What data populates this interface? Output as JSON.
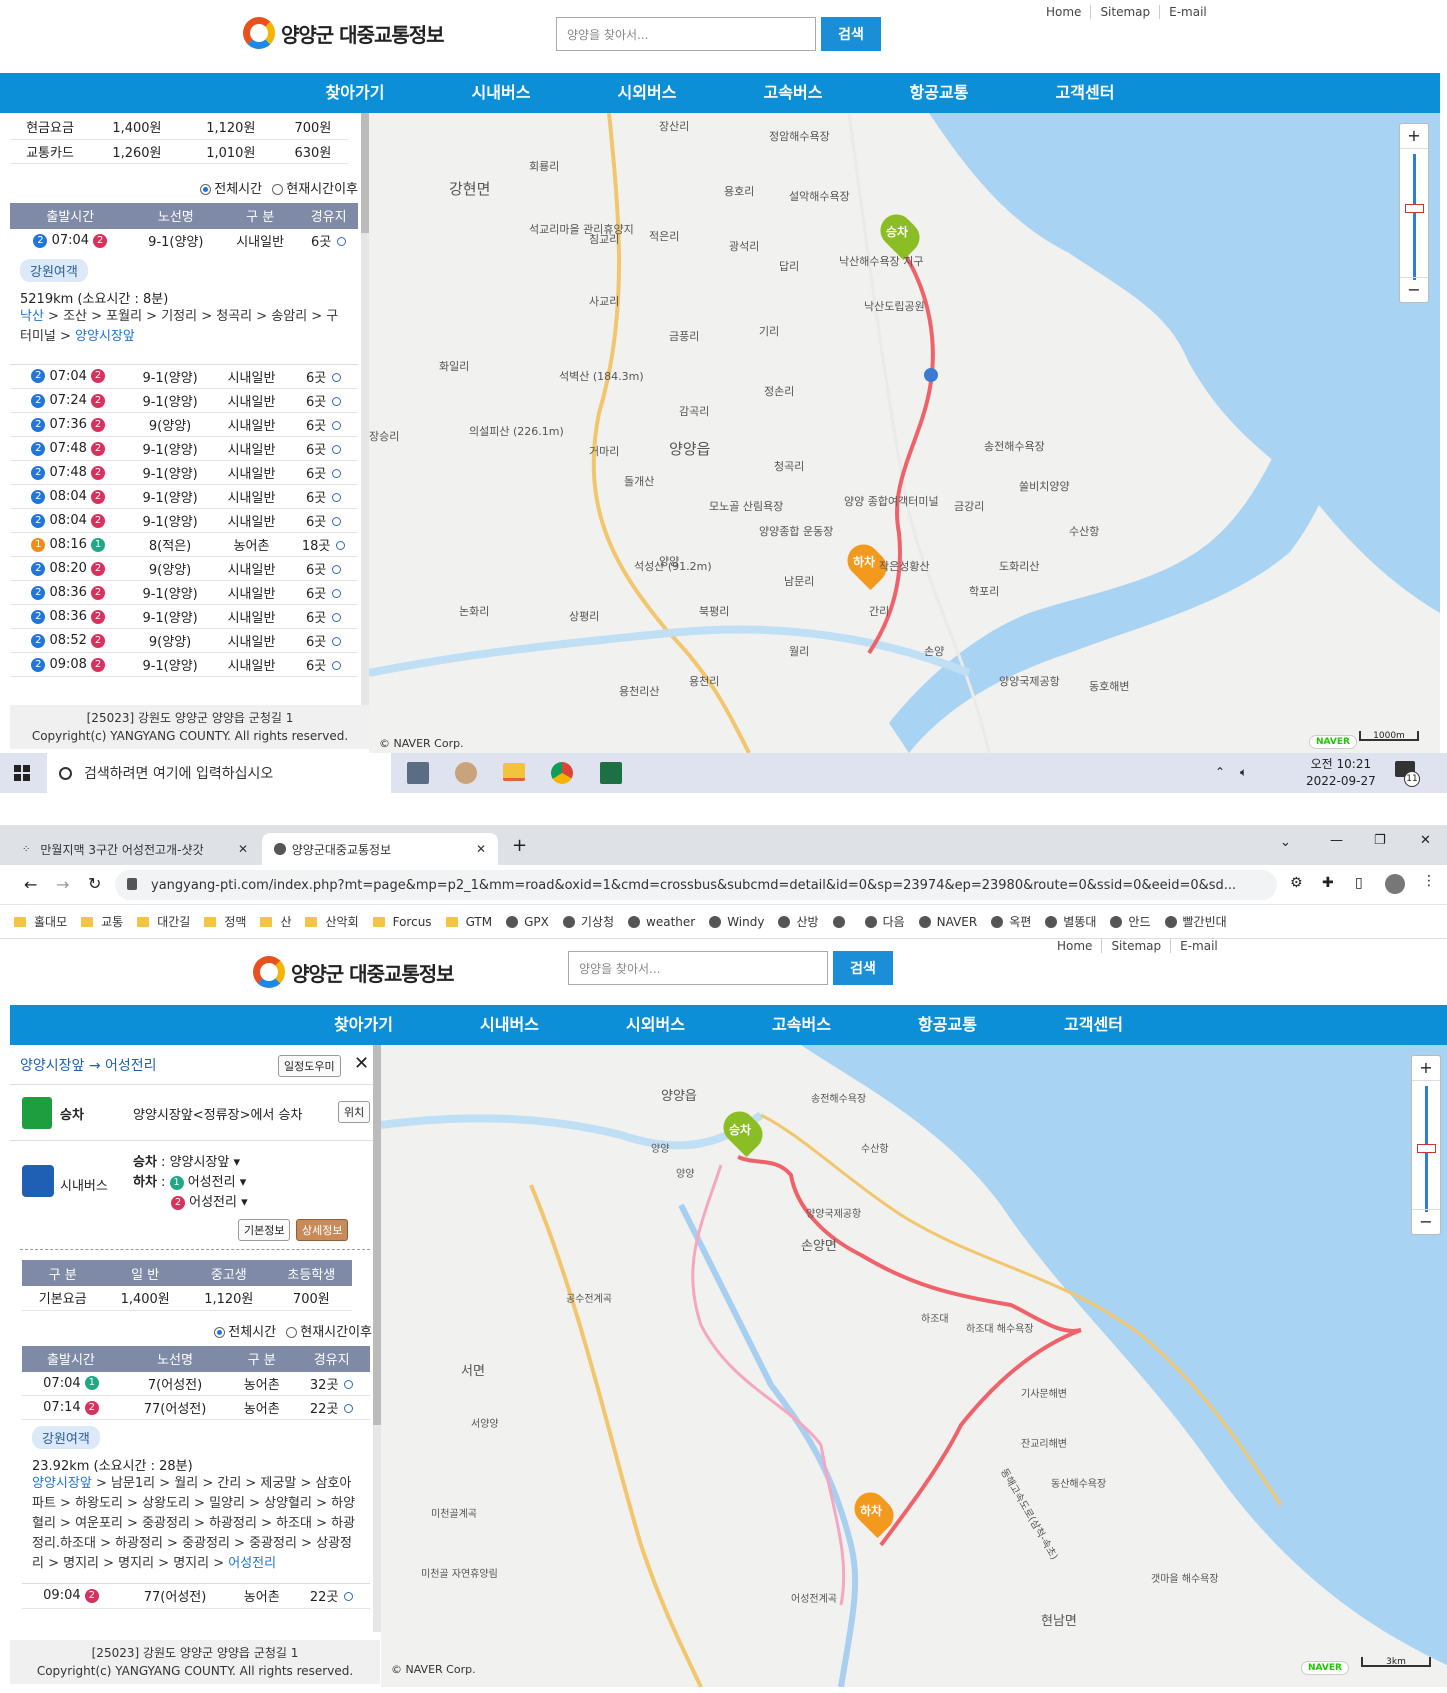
{
  "site": {
    "title": "양양군 대중교통정보",
    "search_placeholder": "양양을 찾아서...",
    "search_button": "검색",
    "top_links": [
      "Home",
      "Sitemap",
      "E-mail"
    ],
    "nav": [
      "찾아가기",
      "시내버스",
      "시외버스",
      "고속버스",
      "항공교통",
      "고객센터"
    ],
    "footer_address": "[25023] 강원도 양양군 양양읍 군청길 1",
    "footer_copyright": "Copyright(c) YANGYANG COUNTY. All rights reserved."
  },
  "top": {
    "fare_rows": [
      {
        "label": "현금요금",
        "general": "1,400원",
        "youth": "1,120원",
        "child": "700원"
      },
      {
        "label": "교통카드",
        "general": "1,260원",
        "youth": "1,010원",
        "child": "630원"
      }
    ],
    "radio_all": "전체시간",
    "radio_after": "현재시간이후",
    "headers": [
      "출발시간",
      "노선명",
      "구 분",
      "경유지"
    ],
    "first_row": {
      "num": "2",
      "time": "07:04",
      "rn": "2",
      "route": "9-1(양양)",
      "type": "시내일반",
      "stops": "6곳"
    },
    "detail": {
      "tag": "강원여객",
      "summary": "5219km (소요시간 : 8분)",
      "stops_start": "낙산",
      "stops_middle": " > 조산 > 포월리 > 기정리 > 청곡리 > 송암리 > 구터미널 > ",
      "stops_end": "양양시장앞"
    },
    "rows": [
      {
        "num": "2",
        "time": "07:04",
        "rn": "2",
        "route": "9-1(양양)",
        "type": "시내일반",
        "stops": "6곳",
        "color": "blue",
        "rcolor": "red"
      },
      {
        "num": "2",
        "time": "07:24",
        "rn": "2",
        "route": "9-1(양양)",
        "type": "시내일반",
        "stops": "6곳",
        "color": "blue",
        "rcolor": "red"
      },
      {
        "num": "2",
        "time": "07:36",
        "rn": "2",
        "route": "9(양양)",
        "type": "시내일반",
        "stops": "6곳",
        "color": "blue",
        "rcolor": "red"
      },
      {
        "num": "2",
        "time": "07:48",
        "rn": "2",
        "route": "9-1(양양)",
        "type": "시내일반",
        "stops": "6곳",
        "color": "blue",
        "rcolor": "red"
      },
      {
        "num": "2",
        "time": "07:48",
        "rn": "2",
        "route": "9-1(양양)",
        "type": "시내일반",
        "stops": "6곳",
        "color": "blue",
        "rcolor": "red"
      },
      {
        "num": "2",
        "time": "08:04",
        "rn": "2",
        "route": "9-1(양양)",
        "type": "시내일반",
        "stops": "6곳",
        "color": "blue",
        "rcolor": "red"
      },
      {
        "num": "2",
        "time": "08:04",
        "rn": "2",
        "route": "9-1(양양)",
        "type": "시내일반",
        "stops": "6곳",
        "color": "blue",
        "rcolor": "red"
      },
      {
        "num": "1",
        "time": "08:16",
        "rn": "1",
        "route": "8(적은)",
        "type": "농어촌",
        "stops": "18곳",
        "color": "orange",
        "rcolor": "teal"
      },
      {
        "num": "2",
        "time": "08:20",
        "rn": "2",
        "route": "9(양양)",
        "type": "시내일반",
        "stops": "6곳",
        "color": "blue",
        "rcolor": "red"
      },
      {
        "num": "2",
        "time": "08:36",
        "rn": "2",
        "route": "9-1(양양)",
        "type": "시내일반",
        "stops": "6곳",
        "color": "blue",
        "rcolor": "red"
      },
      {
        "num": "2",
        "time": "08:36",
        "rn": "2",
        "route": "9-1(양양)",
        "type": "시내일반",
        "stops": "6곳",
        "color": "blue",
        "rcolor": "red"
      },
      {
        "num": "2",
        "time": "08:52",
        "rn": "2",
        "route": "9(양양)",
        "type": "시내일반",
        "stops": "6곳",
        "color": "blue",
        "rcolor": "red"
      },
      {
        "num": "2",
        "time": "09:08",
        "rn": "2",
        "route": "9-1(양양)",
        "type": "시내일반",
        "stops": "6곳",
        "color": "blue",
        "rcolor": "red"
      }
    ],
    "map_labels": {
      "board": "승차",
      "alight": "하차",
      "places": [
        "장산리",
        "정암해수욕장",
        "회룡리",
        "강현면",
        "용호리",
        "설악해수욕장",
        "석교리마을 관리휴양지",
        "침교리",
        "적은리",
        "광석리",
        "답리",
        "낙산해수욕장 지구",
        "낙산도립공원",
        "사교리",
        "금풍리",
        "기리",
        "화일리",
        "석벽산 (184.3m)",
        "정손리",
        "감곡리",
        "의설피산 (226.1m)",
        "장승리",
        "거마리",
        "양양읍",
        "청곡리",
        "송전해수욕장",
        "쏠비치양양",
        "돌개산",
        "모노골 산림욕장",
        "양양종합 운동장",
        "양양 종합여객터미널",
        "금강리",
        "수산항",
        "석성산 (91.2m)",
        "양양",
        "남문리",
        "작은성황산",
        "도화리산",
        "논화리",
        "상평리",
        "북평리",
        "간리",
        "학포리",
        "월리",
        "손양",
        "용천리",
        "용천리산",
        "양양국제공항",
        "동호해변"
      ],
      "scale": "1000m"
    },
    "naver": "NAVER",
    "copyright_map": "© NAVER Corp."
  },
  "taskbar": {
    "search": "검색하려면 여기에 입력하십시오",
    "time": "오전 10:21",
    "date": "2022-09-27",
    "notif": "11"
  },
  "browser": {
    "tab1": "만월지맥 3구간 어성전고개-샷갓",
    "tab2": "양양군대중교통정보",
    "url": "yangyang-pti.com/index.php?mt=page&mp=p2_1&mm=road&oxid=1&cmd=crossbus&subcmd=detail&id=0&sp=23974&ep=23980&route=0&ssid=0&eeid=0&sd...",
    "bookmarks": [
      "홀대모",
      "교통",
      "대간길",
      "정맥",
      "산",
      "산악회",
      "Forcus",
      "GTM",
      "GPX",
      "기상청",
      "weather",
      "Windy",
      "산방",
      "",
      "다음",
      "NAVER",
      "옥편",
      "별똥대",
      "안드",
      "빨간빈대"
    ]
  },
  "bottom": {
    "route_title_from": "양양시장앞",
    "route_arrow": " → ",
    "route_title_to": "어성전리",
    "schedule_help": "일정도우미",
    "board_label": "승차",
    "board_text": "양양시장앞<정류장>에서 승차",
    "location_btn": "위치",
    "bus_label": "시내버스",
    "bus_board_key": "승차",
    "bus_board_val": "양양시장앞",
    "bus_alight_key": "하차",
    "alight_options": [
      {
        "n": "1",
        "name": "어성전리"
      },
      {
        "n": "2",
        "name": "어성전리"
      }
    ],
    "basic_info": "기본정보",
    "detail_info": "상세정보",
    "fare_headers": [
      "구 분",
      "일 반",
      "중고생",
      "초등학생"
    ],
    "fare_row": {
      "label": "기본요금",
      "general": "1,400원",
      "youth": "1,120원",
      "child": "700원"
    },
    "radio_all": "전체시간",
    "radio_after": "현재시간이후",
    "headers": [
      "출발시간",
      "노선명",
      "구 분",
      "경유지"
    ],
    "rows_before": [
      {
        "time": "07:04",
        "rn": "1",
        "rcolor": "teal",
        "route": "7(어성전)",
        "type": "농어촌",
        "stops": "32곳"
      },
      {
        "time": "07:14",
        "rn": "2",
        "rcolor": "red",
        "route": "77(어성전)",
        "type": "농어촌",
        "stops": "22곳"
      }
    ],
    "detail": {
      "tag": "강원여객",
      "summary": "23.92km (소요시간 : 28분)",
      "stops_start": "양양시장앞",
      "stops_middle": " > 남문1리 > 월리 > 간리 > 제궁말 > 삼호아파트 > 하왕도리 > 상왕도리 > 밀양리 > 상양혈리 > 하양혈리 > 여운포리 > 중광정리 > 하광정리 > 하조대 > 하광정리.하조대 > 하광정리 > 중광정리 > 중광정리 > 상광정리 > 명지리 > 명지리 > 명지리 > ",
      "stops_end": "어성전리"
    },
    "rows_after": [
      {
        "time": "09:04",
        "rn": "2",
        "rcolor": "red",
        "route": "77(어성전)",
        "type": "농어촌",
        "stops": "22곳"
      }
    ],
    "map_labels": {
      "board": "승차",
      "alight": "하차",
      "places": [
        "양양읍",
        "송전해수욕장",
        "수산항",
        "양양",
        "양양",
        "양양국제공항",
        "손양면",
        "공수전계곡",
        "서면",
        "하조대",
        "하조대 해수욕장",
        "기사문해변",
        "서양양",
        "잔교리해변",
        "동산해수욕장",
        "미천골계곡",
        "미천골 자연휴양림",
        "어성전계곡",
        "현남면",
        "갯마을 해수욕장",
        "동해고속도로(삼척-속초)"
      ],
      "scale": "3km"
    },
    "naver": "NAVER",
    "copyright_map": "© NAVER Corp."
  }
}
